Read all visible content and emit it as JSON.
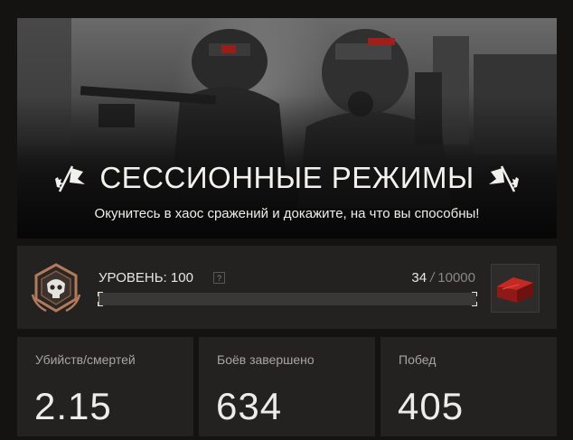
{
  "banner": {
    "title": "СЕССИОННЫЕ РЕЖИМЫ",
    "subtitle": "Окунитесь в хаос сражений и докажите, на что вы способны!",
    "left_icon": "flag-icon",
    "right_icon": "flag-icon"
  },
  "level": {
    "label": "УРОВЕНЬ: 100",
    "help_glyph": "?",
    "progress_current": "34",
    "progress_separator": "/",
    "progress_max": "10000",
    "progress_fraction": 0.0034,
    "badge_icon": "rank-skull-badge-icon",
    "reward_icon": "red-crate-icon"
  },
  "stats": [
    {
      "label": "Убийств/смертей",
      "value": "2.15"
    },
    {
      "label": "Боёв завершено",
      "value": "634"
    },
    {
      "label": "Побед",
      "value": "405"
    }
  ],
  "colors": {
    "background": "#141312",
    "panel": "#242220",
    "text": "#e8e6e2",
    "muted": "#a9a5a0",
    "bronze": "#b27a5c",
    "crate_red": "#b3221e"
  }
}
